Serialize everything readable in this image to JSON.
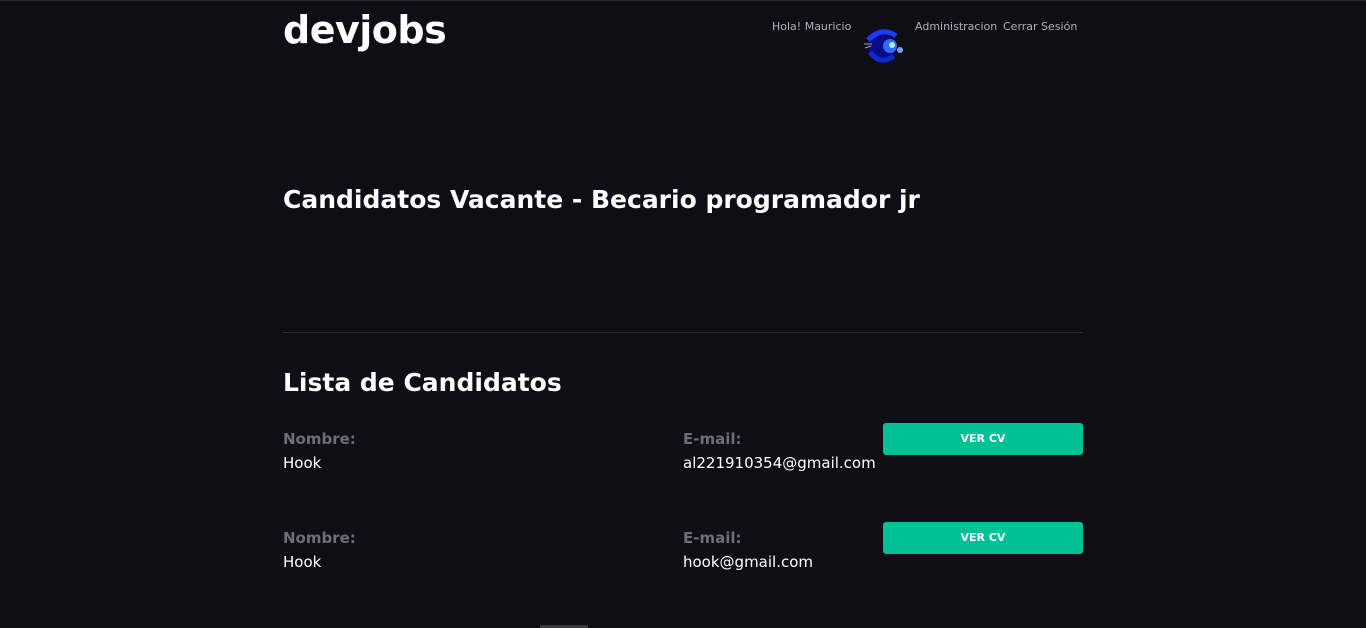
{
  "header": {
    "logo": "devjobs",
    "greeting": "Hola! Mauricio",
    "avatar_icon": "user-avatar-icon",
    "admin_link": "Administracion",
    "logout_link": "Cerrar Sesión"
  },
  "main": {
    "title": "Candidatos Vacante - Becario programador jr",
    "section_title": "Lista de Candidatos",
    "candidates": [
      {
        "name_label": "Nombre:",
        "name": "Hook",
        "email_label": "E-mail:",
        "email": "al221910354@gmail.com",
        "cv_button": "VER CV"
      },
      {
        "name_label": "Nombre:",
        "name": "Hook",
        "email_label": "E-mail:",
        "email": "hook@gmail.com",
        "cv_button": "VER CV"
      }
    ]
  },
  "colors": {
    "background": "#0f0e17",
    "accent": "#00c096",
    "muted_label": "#6e6d78"
  }
}
